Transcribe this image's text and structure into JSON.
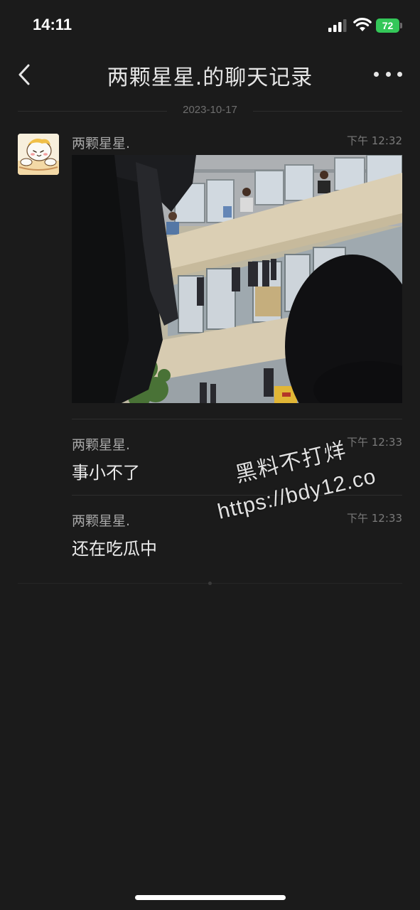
{
  "status_bar": {
    "time": "14:11",
    "battery": "72",
    "icons": [
      "signal-icon",
      "wifi-icon",
      "battery-icon"
    ],
    "battery_color": "#34c759"
  },
  "header": {
    "title": "两颗星星.的聊天记录",
    "back_icon": "chevron-left-icon",
    "more_icon": "more-horizontal-icon"
  },
  "date_separator": "2023-10-17",
  "messages": [
    {
      "sender": "两颗星星.",
      "time": "下午 12:32",
      "type": "image"
    },
    {
      "sender": "两颗星星.",
      "time": "下午 12:33",
      "type": "text",
      "text": "事小不了"
    },
    {
      "sender": "两颗星星.",
      "time": "下午 12:33",
      "type": "text",
      "text": "还在吃瓜中"
    }
  ],
  "watermark": {
    "line1": "黑料不打烊",
    "line2": "https://bdy12.co"
  },
  "colors": {
    "background": "#1b1b1b",
    "text_primary": "#ececec",
    "text_secondary": "#a7a7a7",
    "text_muted": "#7a7a7a"
  }
}
